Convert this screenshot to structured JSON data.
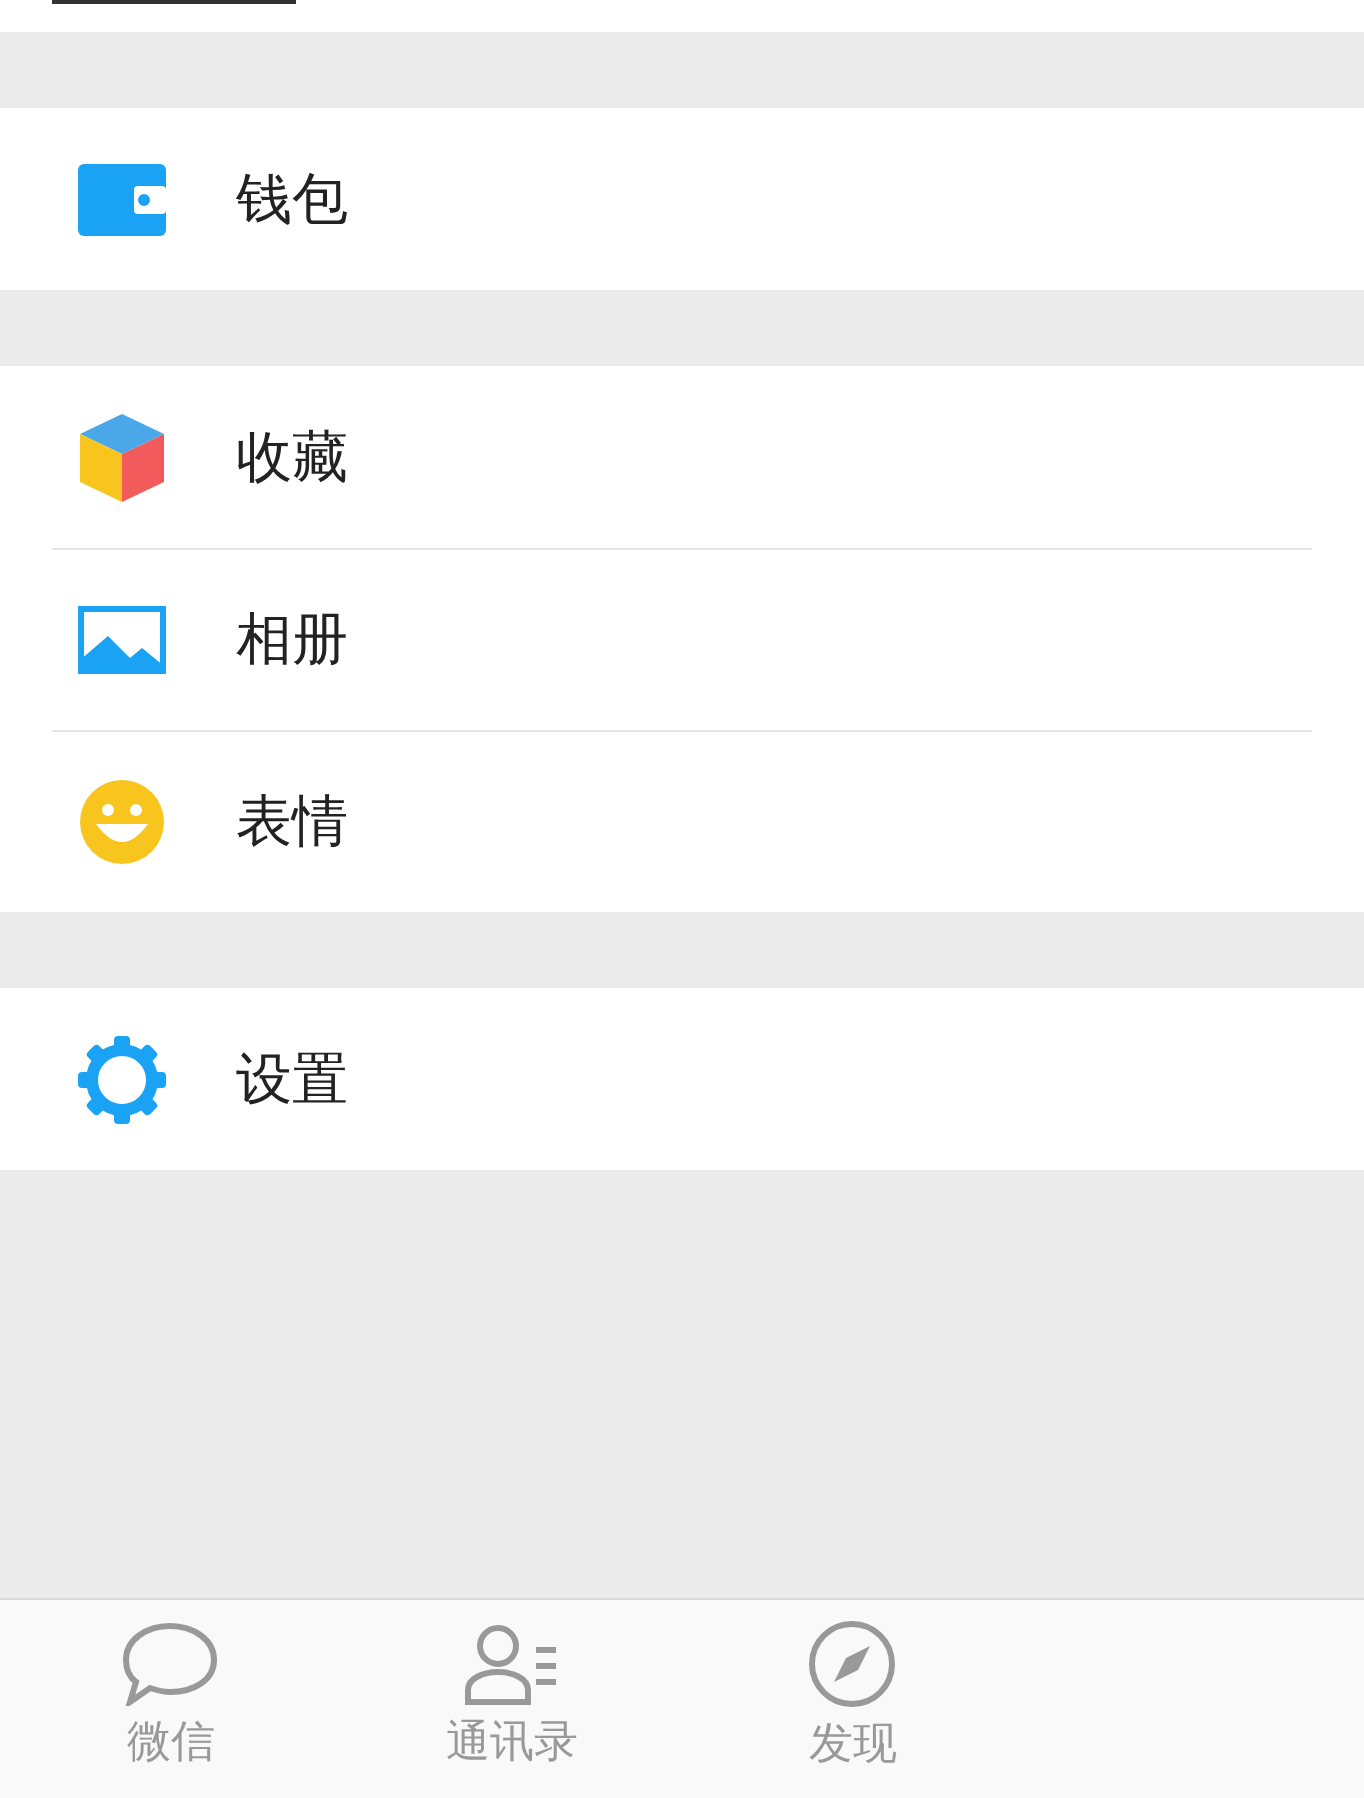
{
  "menu_groups": [
    {
      "items": [
        {
          "kind": "wallet",
          "label": "钱包"
        }
      ]
    },
    {
      "items": [
        {
          "kind": "favorites",
          "label": "收藏"
        },
        {
          "kind": "album",
          "label": "相册"
        },
        {
          "kind": "stickers",
          "label": "表情"
        }
      ]
    },
    {
      "items": [
        {
          "kind": "settings",
          "label": "设置"
        }
      ]
    }
  ],
  "tab_bar": [
    {
      "kind": "chats",
      "label": "微信",
      "selected": false
    },
    {
      "kind": "contacts",
      "label": "通讯录",
      "selected": false
    },
    {
      "kind": "discover",
      "label": "发现",
      "selected": false
    }
  ]
}
